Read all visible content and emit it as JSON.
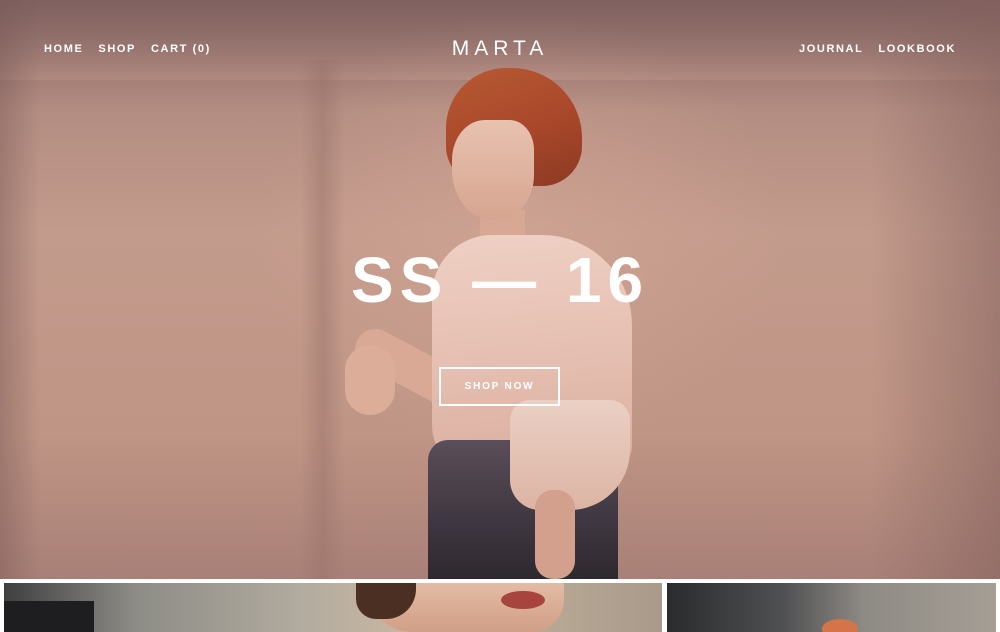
{
  "nav": {
    "left": [
      {
        "label": "HOME"
      },
      {
        "label": "SHOP"
      },
      {
        "label": "CART (0)"
      }
    ],
    "right": [
      {
        "label": "JOURNAL"
      },
      {
        "label": "LOOKBOOK"
      }
    ]
  },
  "brand": {
    "name": "MARTA"
  },
  "hero": {
    "headline": "SS — 16",
    "cta_label": "SHOP NOW"
  },
  "colors": {
    "text": "#ffffff",
    "hero_tint": "#c39b8c"
  }
}
